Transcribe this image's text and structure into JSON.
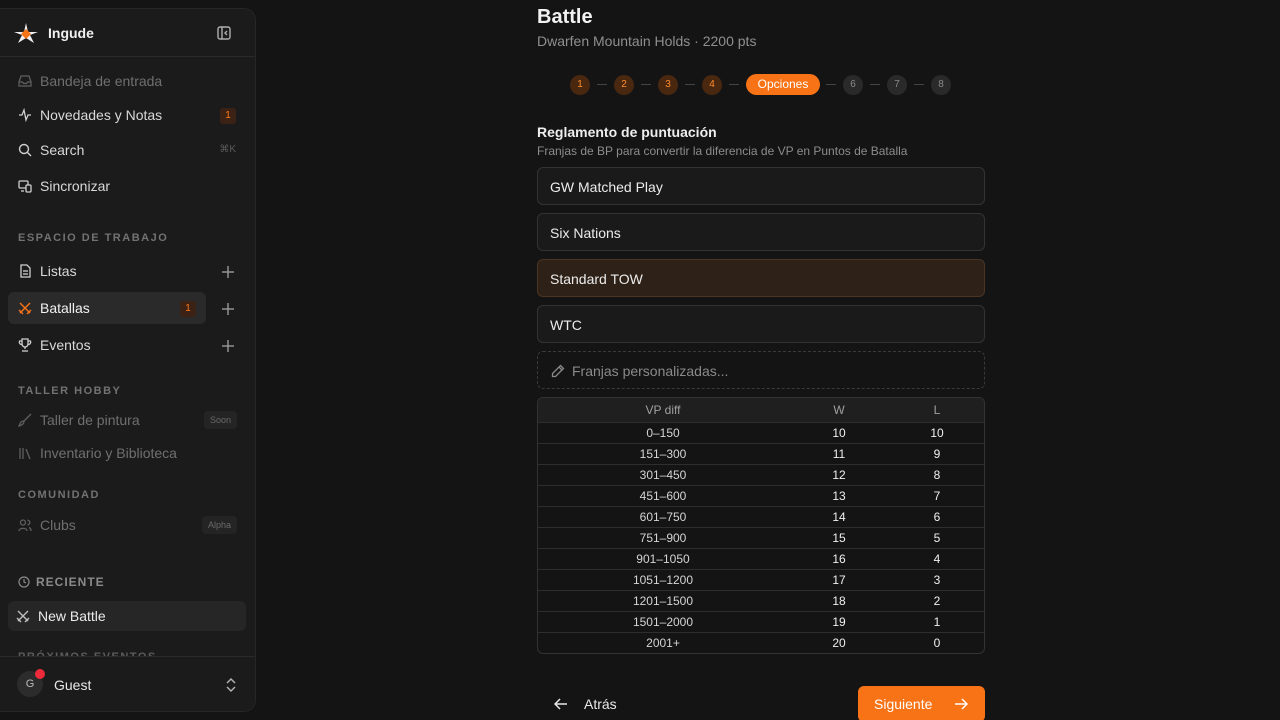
{
  "app": {
    "name": "Ingude"
  },
  "sidebar": {
    "top_items": [
      {
        "label": "Bandeja de entrada",
        "icon": "inbox-icon",
        "disabled": true
      },
      {
        "label": "Novedades y Notas",
        "icon": "activity-icon",
        "badge": "1"
      },
      {
        "label": "Search",
        "icon": "search-icon",
        "shortcut": "⌘K"
      },
      {
        "label": "Sincronizar",
        "icon": "sync-devices-icon"
      }
    ],
    "workspace": {
      "title": "ESPACIO DE TRABAJO",
      "items": [
        {
          "label": "Listas",
          "icon": "file-icon"
        },
        {
          "label": "Batallas",
          "icon": "crossed-swords-icon",
          "badge": "1",
          "active": true
        },
        {
          "label": "Eventos",
          "icon": "trophy-icon"
        }
      ]
    },
    "hobby": {
      "title": "TALLER HOBBY",
      "items": [
        {
          "label": "Taller de pintura",
          "icon": "brush-icon",
          "tag": "Soon"
        },
        {
          "label": "Inventario y Biblioteca",
          "icon": "library-icon"
        }
      ]
    },
    "community": {
      "title": "COMUNIDAD",
      "items": [
        {
          "label": "Clubs",
          "icon": "users-icon",
          "tag": "Alpha"
        }
      ]
    },
    "recent": {
      "title": "RECIENTE",
      "items": [
        {
          "label": "New Battle",
          "icon": "crossed-swords-icon"
        }
      ]
    },
    "upcoming_title": "PRÓXIMOS EVENTOS",
    "user": {
      "initial": "G",
      "name": "Guest"
    }
  },
  "main": {
    "title": "Battle",
    "subtitle": "Dwarfen Mountain Holds · 2200 pts",
    "steps": [
      "1",
      "2",
      "3",
      "4",
      "Opciones",
      "6",
      "7",
      "8"
    ],
    "current_step_index": 4,
    "accent_color": "#f77316",
    "scoring": {
      "title": "Reglamento de puntuación",
      "description": "Franjas de BP para convertir la diferencia de VP en Puntos de Batalla",
      "options": [
        "GW Matched Play",
        "Six Nations",
        "Standard TOW",
        "WTC"
      ],
      "selected": "Standard TOW",
      "custom_placeholder": "Franjas personalizadas..."
    },
    "table": {
      "headers": [
        "VP diff",
        "W",
        "L"
      ],
      "rows": [
        [
          "0–150",
          "10",
          "10"
        ],
        [
          "151–300",
          "11",
          "9"
        ],
        [
          "301–450",
          "12",
          "8"
        ],
        [
          "451–600",
          "13",
          "7"
        ],
        [
          "601–750",
          "14",
          "6"
        ],
        [
          "751–900",
          "15",
          "5"
        ],
        [
          "901–1050",
          "16",
          "4"
        ],
        [
          "1051–1200",
          "17",
          "3"
        ],
        [
          "1201–1500",
          "18",
          "2"
        ],
        [
          "1501–2000",
          "19",
          "1"
        ],
        [
          "2001+",
          "20",
          "0"
        ]
      ]
    },
    "nav": {
      "back": "Atrás",
      "next": "Siguiente"
    }
  }
}
